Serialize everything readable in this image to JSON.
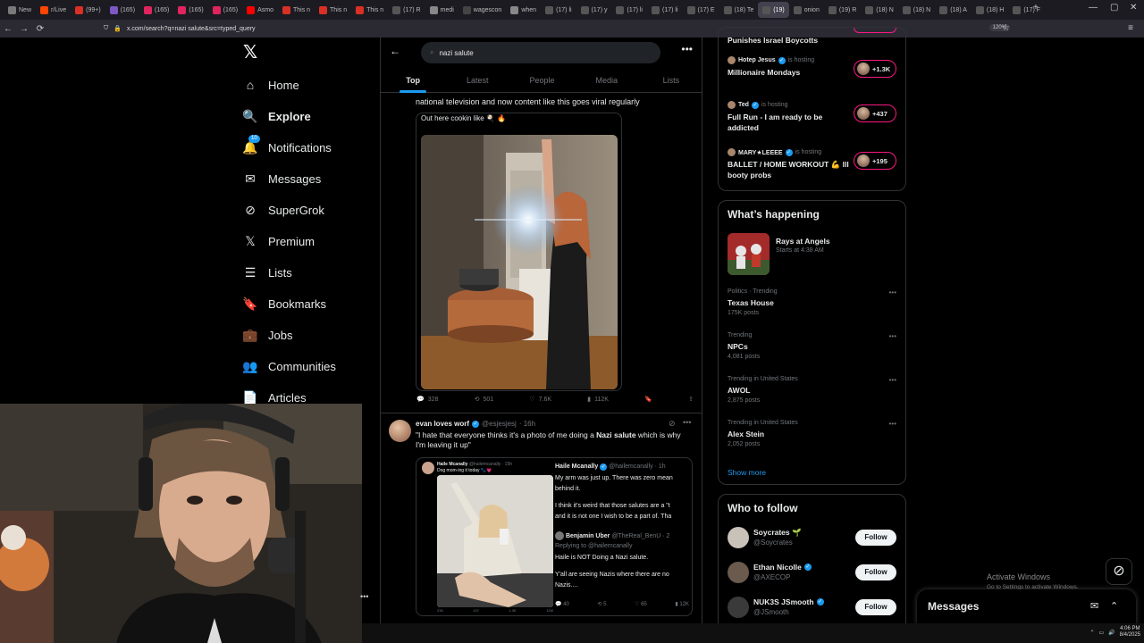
{
  "browser": {
    "tabs": [
      {
        "label": "New",
        "color": "#7a7a7a"
      },
      {
        "label": "r/Live",
        "color": "#ff4500"
      },
      {
        "label": "(99+)",
        "color": "#d93025"
      },
      {
        "label": "(165)",
        "color": "#7e57c2"
      },
      {
        "label": "(165)",
        "color": "#e0245e"
      },
      {
        "label": "(165)",
        "color": "#e0245e"
      },
      {
        "label": "(165)",
        "color": "#e0245e"
      },
      {
        "label": "Asmo",
        "color": "#ff0000"
      },
      {
        "label": "This n",
        "color": "#d93025"
      },
      {
        "label": "This n",
        "color": "#d93025"
      },
      {
        "label": "This n",
        "color": "#d93025"
      },
      {
        "label": "(17) R",
        "color": "#555"
      },
      {
        "label": "medi",
        "color": "#888"
      },
      {
        "label": "wagescon",
        "color": "#444"
      },
      {
        "label": "when",
        "color": "#888"
      },
      {
        "label": "(17) li",
        "color": "#555"
      },
      {
        "label": "(17) y",
        "color": "#555"
      },
      {
        "label": "(17) li",
        "color": "#555"
      },
      {
        "label": "(17) li",
        "color": "#555"
      },
      {
        "label": "(17) E",
        "color": "#555"
      },
      {
        "label": "(18) Te",
        "color": "#555"
      },
      {
        "label": "(19)",
        "color": "#555"
      },
      {
        "label": "onion",
        "color": "#555"
      },
      {
        "label": "(19) R",
        "color": "#555"
      },
      {
        "label": "(18) N",
        "color": "#555"
      },
      {
        "label": "(18) N",
        "color": "#555"
      },
      {
        "label": "(18) A",
        "color": "#555"
      },
      {
        "label": "(18) H",
        "color": "#555"
      },
      {
        "label": "(17) F",
        "color": "#555"
      }
    ],
    "url": "x.com/search?q=nazi salute&src=typed_query",
    "zoom": "120%"
  },
  "nav": {
    "items": [
      {
        "label": "Home",
        "icon": "home-icon",
        "glyph": "⌂"
      },
      {
        "label": "Explore",
        "icon": "search-icon",
        "glyph": "🔍"
      },
      {
        "label": "Notifications",
        "icon": "bell-icon",
        "glyph": "🔔",
        "badge": "10"
      },
      {
        "label": "Messages",
        "icon": "mail-icon",
        "glyph": "✉"
      },
      {
        "label": "SuperGrok",
        "icon": "grok-icon",
        "glyph": "⊘"
      },
      {
        "label": "Premium",
        "icon": "x-icon",
        "glyph": "𝕏"
      },
      {
        "label": "Lists",
        "icon": "list-icon",
        "glyph": "☰"
      },
      {
        "label": "Bookmarks",
        "icon": "bookmark-icon",
        "glyph": "🔖"
      },
      {
        "label": "Jobs",
        "icon": "briefcase-icon",
        "glyph": "💼"
      },
      {
        "label": "Communities",
        "icon": "people-icon",
        "glyph": "👥"
      },
      {
        "label": "Articles",
        "icon": "article-icon",
        "glyph": "📄"
      }
    ]
  },
  "search": {
    "query": "nazi salute",
    "tabs": [
      "Top",
      "Latest",
      "People",
      "Media",
      "Lists"
    ]
  },
  "post1": {
    "text": "national television and now content like this goes viral regularly",
    "quote_text": "Out here cookin like 🍳 🔥",
    "replies": "328",
    "reposts": "501",
    "likes": "7.6K",
    "views": "112K"
  },
  "post2": {
    "name": "evan loves worf",
    "handle": "@esjesjesj",
    "time": "· 16h",
    "text_before": "\"I hate that everyone thinks it's a photo of me doing a ",
    "text_bold": "Nazi salute",
    "text_after": " which is why I'm leaving it up\"",
    "quote": {
      "small_name": "Haile Mcanally",
      "small_handle": "@hailemcanally · 15h",
      "small_text": "Dog mom-ing it today 🐾💗",
      "right_name": "Haile Mcanally",
      "right_handle": "@hailemcanally · 1h",
      "right_text1": "My arm was just up. There was zero mean",
      "right_text2": "behind it.",
      "right_text3": "I think it's weird that those salutes are a \"t",
      "right_text4": "and it is not one I wish to be a part of. Tha",
      "reply_name": "Benjamin Uber",
      "reply_handle": "@TheReal_BenU · 2",
      "replying_to": "Replying to @hailemcanally",
      "reply_text1": "Haile is NOT Doing a Nazi salute.",
      "reply_text2": "Y'all are seeing Nazis where there are no",
      "reply_text3": "Nazis....",
      "stats_replies": "40",
      "stats_reposts": "5",
      "stats_likes": "65",
      "stats_views": "12K",
      "mini_stats": [
        "236",
        "107",
        "1.3K",
        "12M"
      ]
    }
  },
  "spaces": {
    "top_title": "Punishes Israel Boycotts",
    "items": [
      {
        "host": "Hotep Jesus",
        "status": "is hosting",
        "title": "Millionaire Mondays",
        "count": "+1.3K"
      },
      {
        "host": "Ted",
        "status": "is hosting",
        "title": "Full Run - I am ready to be addicted",
        "count": "+437"
      },
      {
        "host": "MARY★LEEEE",
        "status": "is hosting",
        "title": "BALLET / HOME WORKOUT 💪 lll booty probs",
        "count": "+195"
      }
    ]
  },
  "happening": {
    "title": "What’s happening",
    "event_name": "Rays at Angels",
    "event_time": "Starts at 4:38 AM",
    "trends": [
      {
        "meta": "Politics · Trending",
        "name": "Texas House",
        "posts": "175K posts"
      },
      {
        "meta": "Trending",
        "name": "NPCs",
        "posts": "4,081 posts"
      },
      {
        "meta": "Trending in United States",
        "name": "AWOL",
        "posts": "2,875 posts"
      },
      {
        "meta": "Trending in United States",
        "name": "Alex Stein",
        "posts": "2,052 posts"
      }
    ],
    "show_more": "Show more"
  },
  "who_to_follow": {
    "title": "Who to follow",
    "users": [
      {
        "name": "Soycrates 🌱",
        "handle": "@Soycrates",
        "verified": false,
        "color": "#c9c2b8"
      },
      {
        "name": "Ethan Nicolle",
        "handle": "@AXECOP",
        "verified": true,
        "color": "#6b5a4e"
      },
      {
        "name": "NUK3S JSmooth",
        "handle": "@JSmooth",
        "verified": true,
        "color": "#3a3a3a"
      }
    ],
    "follow_label": "Follow"
  },
  "messages_label": "Messages",
  "windows": {
    "activate_title": "Activate Windows",
    "activate_sub": "Go to Settings to activate Windows.",
    "time": "4:06 PM",
    "date": "8/4/2025"
  }
}
